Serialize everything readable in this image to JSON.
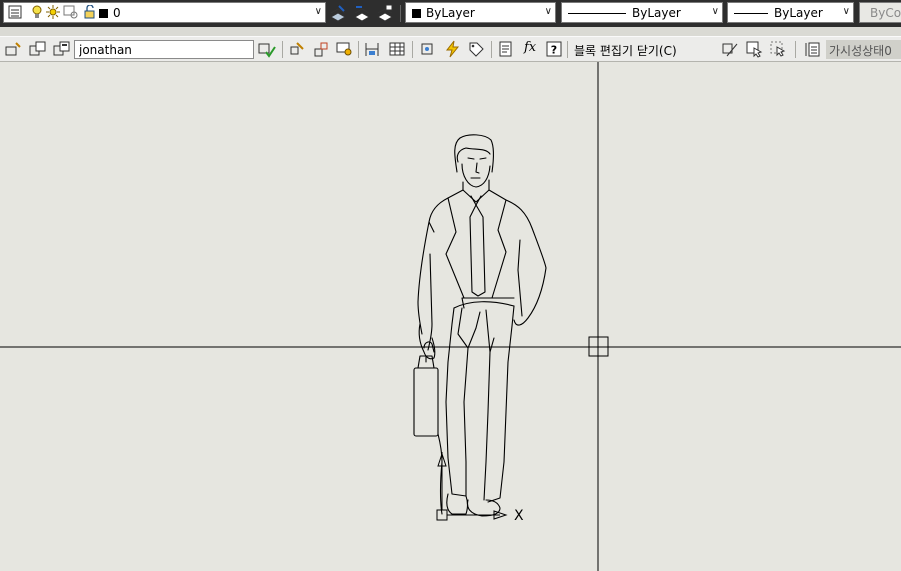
{
  "layer_toolbar": {
    "layer_name": "0",
    "color": "ByLayer",
    "linetype": "ByLayer",
    "lineweight": "ByLayer",
    "plotstyle": "ByCo",
    "icons": [
      "layer-manager-icon",
      "light-bulb-icon",
      "sun-icon",
      "freeze-viewport-icon",
      "lock-icon",
      "make-current-icon",
      "layer-previous-icon",
      "layer-states-icon"
    ]
  },
  "block_editor": {
    "block_name": "jonathan",
    "close_label": "블록 편집기 닫기(C)",
    "visibility_state": "가시성상태0"
  },
  "canvas": {
    "ucs_x_label": "X",
    "colors": {
      "background": "#e6e6e0",
      "lines": "#000000"
    }
  }
}
